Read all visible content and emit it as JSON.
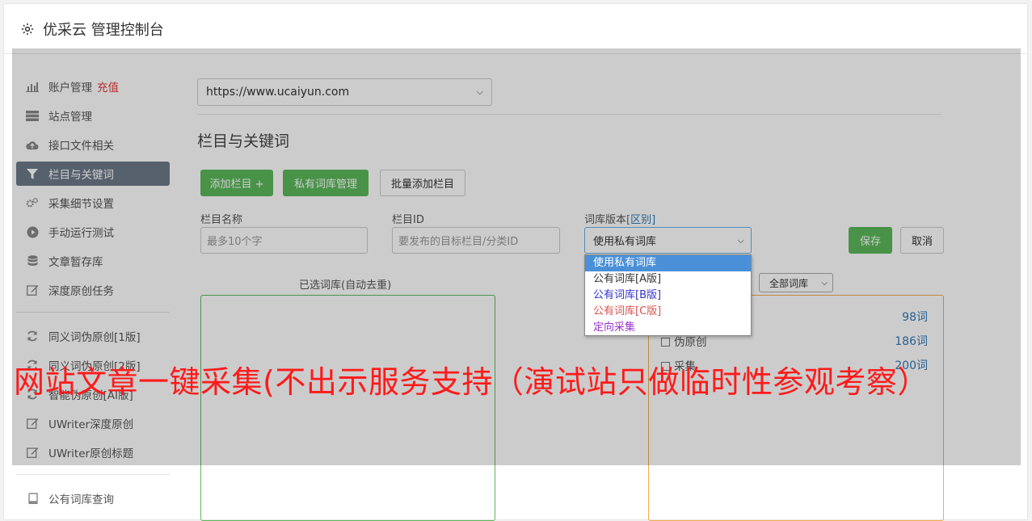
{
  "header": {
    "title": "优采云 管理控制台"
  },
  "sidebar": {
    "group1": [
      {
        "label": "账户管理",
        "extra": "充值",
        "icon": "bar-chart-icon"
      },
      {
        "label": "站点管理",
        "icon": "server-icon"
      },
      {
        "label": "接口文件相关",
        "icon": "cloud-upload-icon"
      },
      {
        "label": "栏目与关键词",
        "icon": "filter-icon",
        "active": true
      },
      {
        "label": "采集细节设置",
        "icon": "cogs-icon"
      },
      {
        "label": "手动运行测试",
        "icon": "play-circle-icon"
      },
      {
        "label": "文章暂存库",
        "icon": "database-icon"
      },
      {
        "label": "深度原创任务",
        "icon": "edit-icon"
      }
    ],
    "group2": [
      {
        "label": "同义词伪原创[1版]",
        "icon": "refresh-icon"
      },
      {
        "label": "同义词伪原创[2版]",
        "icon": "refresh-icon"
      },
      {
        "label": "智能伪原创[AI版]",
        "icon": "refresh-icon"
      },
      {
        "label": "UWriter深度原创",
        "icon": "edit-icon"
      },
      {
        "label": "UWriter原创标题",
        "icon": "edit-icon"
      }
    ],
    "group3": [
      {
        "label": "公有词库查询",
        "icon": "book-icon"
      }
    ]
  },
  "main": {
    "site_select": "https://www.ucaiyun.com",
    "section_title": "栏目与关键词",
    "buttons": {
      "add_column": "添加栏目 +",
      "private_lib": "私有词库管理",
      "batch_add": "批量添加栏目",
      "save": "保存",
      "cancel": "取消"
    },
    "form": {
      "column_name_label": "栏目名称",
      "column_name_placeholder": "最多10个字",
      "column_id_label": "栏目ID",
      "column_id_placeholder": "要发布的目标栏目/分类ID",
      "lib_version_label": "词库版本",
      "lib_version_diff": "[区别]",
      "lib_version_value": "使用私有词库"
    },
    "selected_panel_label": "已选词库(自动去重)",
    "lib_filter": "全部词库",
    "lib_rows": [
      {
        "label": "",
        "count": "98词"
      },
      {
        "label": "伪原创",
        "count": "186词"
      },
      {
        "label": "采集",
        "count": "200词"
      }
    ]
  },
  "dropdown": {
    "options": [
      {
        "label": "使用私有词库",
        "color": "#ffffff",
        "selected": true
      },
      {
        "label": "公有词库[A版]",
        "color": "#333333"
      },
      {
        "label": "公有词库[B版]",
        "color": "#3333cc"
      },
      {
        "label": "公有词库[C版]",
        "color": "#d9534f"
      },
      {
        "label": "定向采集",
        "color": "#9933cc"
      }
    ]
  },
  "banner": {
    "text": "网站文章一键采集(不出示服务支持（演试站只做临时性参观考察）"
  }
}
